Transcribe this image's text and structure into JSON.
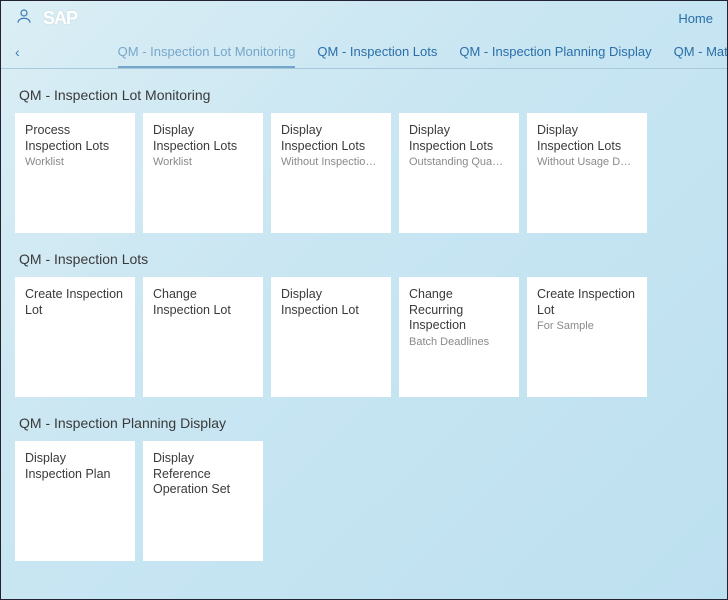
{
  "header": {
    "logo_text": "SAP",
    "home_label": "Home"
  },
  "anchors": {
    "back_glyph": "‹",
    "items": [
      {
        "label": "QM - Inspection Lot Monitoring",
        "active": true,
        "faded": true
      },
      {
        "label": "QM - Inspection Lots",
        "active": false,
        "faded": false
      },
      {
        "label": "QM - Inspection Planning Display",
        "active": false,
        "faded": false
      },
      {
        "label": "QM - Material S",
        "active": false,
        "faded": false
      }
    ]
  },
  "sections": [
    {
      "title": "QM - Inspection Lot Monitoring",
      "tiles": [
        {
          "title": "Process Inspection Lots",
          "sub": "Worklist"
        },
        {
          "title": "Display Inspection Lots",
          "sub": "Worklist"
        },
        {
          "title": "Display Inspection Lots",
          "sub": "Without Inspection C…"
        },
        {
          "title": "Display Inspection Lots",
          "sub": "Outstanding Quantiti…"
        },
        {
          "title": "Display Inspection Lots",
          "sub": "Without Usage Decis…"
        }
      ]
    },
    {
      "title": "QM - Inspection Lots",
      "tiles": [
        {
          "title": "Create Inspection Lot",
          "sub": ""
        },
        {
          "title": "Change Inspection Lot",
          "sub": ""
        },
        {
          "title": "Display Inspection Lot",
          "sub": ""
        },
        {
          "title": "Change Recurring Inspection",
          "sub": "Batch Deadlines"
        },
        {
          "title": "Create Inspection Lot",
          "sub": "For Sample"
        }
      ]
    },
    {
      "title": "QM - Inspection Planning Display",
      "tiles": [
        {
          "title": "Display Inspection Plan",
          "sub": ""
        },
        {
          "title": "Display Reference Operation Set",
          "sub": ""
        }
      ]
    }
  ]
}
